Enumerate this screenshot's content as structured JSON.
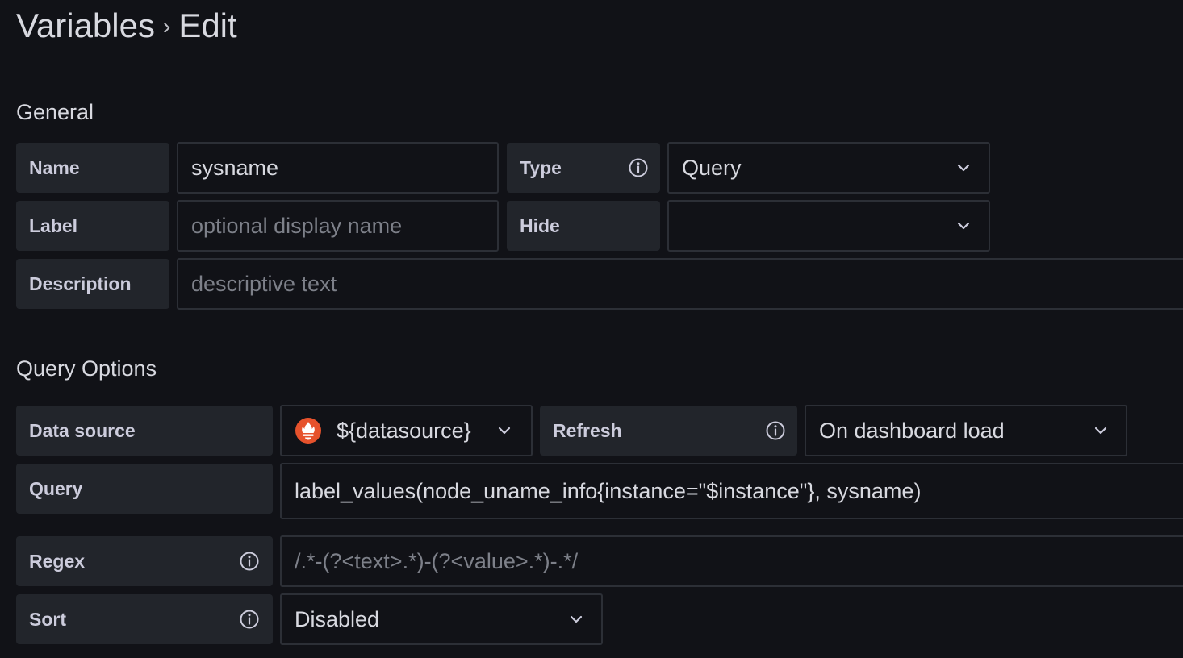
{
  "breadcrumb": {
    "parent": "Variables",
    "separator": "›",
    "current": "Edit"
  },
  "general": {
    "heading": "General",
    "name": {
      "label": "Name",
      "value": "sysname"
    },
    "type": {
      "label": "Type",
      "value": "Query"
    },
    "label": {
      "label": "Label",
      "placeholder": "optional display name"
    },
    "hide": {
      "label": "Hide",
      "value": ""
    },
    "description": {
      "label": "Description",
      "placeholder": "descriptive text"
    }
  },
  "query_options": {
    "heading": "Query Options",
    "data_source": {
      "label": "Data source",
      "value": "${datasource}"
    },
    "refresh": {
      "label": "Refresh",
      "value": "On dashboard load"
    },
    "query": {
      "label": "Query",
      "value": "label_values(node_uname_info{instance=\"$instance\"}, sysname)"
    },
    "regex": {
      "label": "Regex",
      "placeholder": "/.*-(?<text>.*)-(?<value>.*)-.*/"
    },
    "sort": {
      "label": "Sort",
      "value": "Disabled"
    }
  },
  "icons": {
    "info": "info-circle-icon",
    "chevron": "chevron-down-icon",
    "datasource": "prometheus-logo-icon"
  },
  "colors": {
    "background": "#111217",
    "label_bg": "#22252b",
    "border": "#2c2f36",
    "prometheus": "#e6522c"
  }
}
